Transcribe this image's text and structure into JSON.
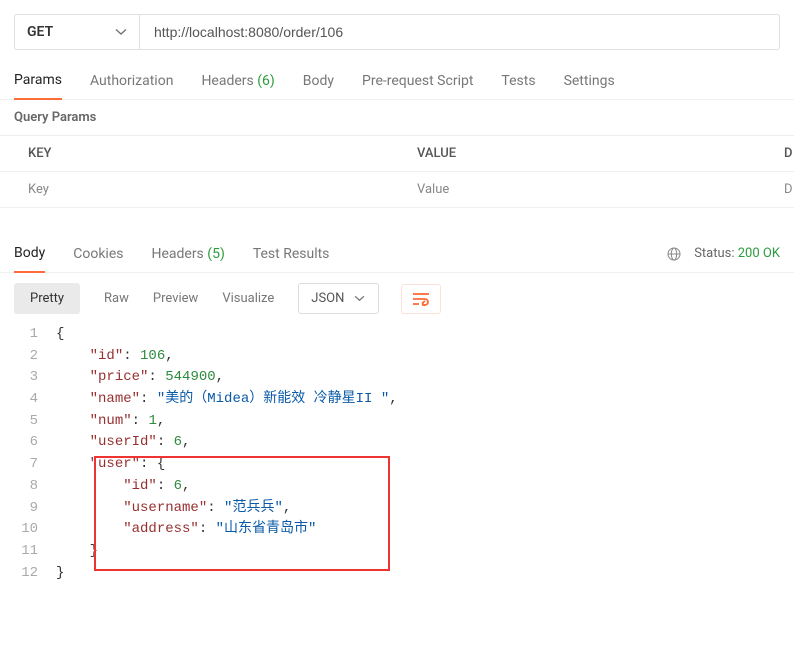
{
  "request": {
    "method": "GET",
    "url": "http://localhost:8080/order/106"
  },
  "tabs": {
    "params": "Params",
    "authorization": "Authorization",
    "headers": "Headers",
    "headers_count": "(6)",
    "body": "Body",
    "prerequest": "Pre-request Script",
    "tests": "Tests",
    "settings": "Settings"
  },
  "query_params_label": "Query Params",
  "kv": {
    "key_header": "KEY",
    "value_header": "VALUE",
    "desc_header": "D",
    "key_placeholder": "Key",
    "value_placeholder": "Value",
    "desc_placeholder": "D"
  },
  "response_tabs": {
    "body": "Body",
    "cookies": "Cookies",
    "headers": "Headers",
    "headers_count": "(5)",
    "test_results": "Test Results",
    "status_label": "Status:",
    "status_value": "200 OK"
  },
  "view": {
    "pretty": "Pretty",
    "raw": "Raw",
    "preview": "Preview",
    "visualize": "Visualize",
    "format": "JSON"
  },
  "code": {
    "l1": "{",
    "l2_k": "\"id\"",
    "l2_v": "106",
    "l3_k": "\"price\"",
    "l3_v": "544900",
    "l4_k": "\"name\"",
    "l4_v": "\"美的（Midea）新能效 冷静星II \"",
    "l5_k": "\"num\"",
    "l5_v": "1",
    "l6_k": "\"userId\"",
    "l6_v": "6",
    "l7_k": "\"user\"",
    "l7_b": "{",
    "l8_k": "\"id\"",
    "l8_v": "6",
    "l9_k": "\"username\"",
    "l9_v": "\"范兵兵\"",
    "l10_k": "\"address\"",
    "l10_v": "\"山东省青岛市\"",
    "l11": "}",
    "l12": "}"
  }
}
